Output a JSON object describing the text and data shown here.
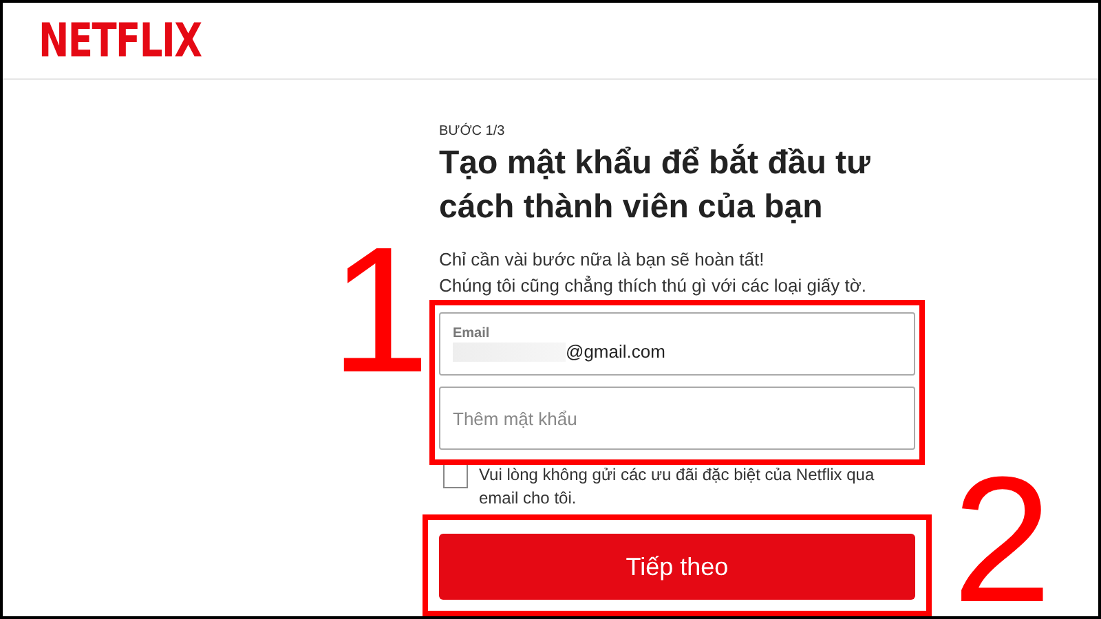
{
  "header": {
    "logo": "NETFLIX"
  },
  "form": {
    "step": "BƯỚC 1/3",
    "title": "Tạo mật khẩu để bắt đầu tư cách thành viên của bạn",
    "subtitle_lines": [
      "Chỉ cần vài bước nữa là bạn sẽ hoàn tất!",
      "Chúng tôi cũng chẳng thích thú gì với các loại giấy tờ."
    ],
    "email": {
      "label": "Email",
      "value": "@gmail.com"
    },
    "password": {
      "placeholder": "Thêm mật khẩu"
    },
    "opt_out": {
      "label": "Vui lòng không gửi các ưu đãi đặc biệt của Netflix qua email cho tôi.",
      "checked": false
    },
    "next_button": "Tiếp theo"
  },
  "annotations": [
    {
      "number": "1"
    },
    {
      "number": "2"
    }
  ]
}
